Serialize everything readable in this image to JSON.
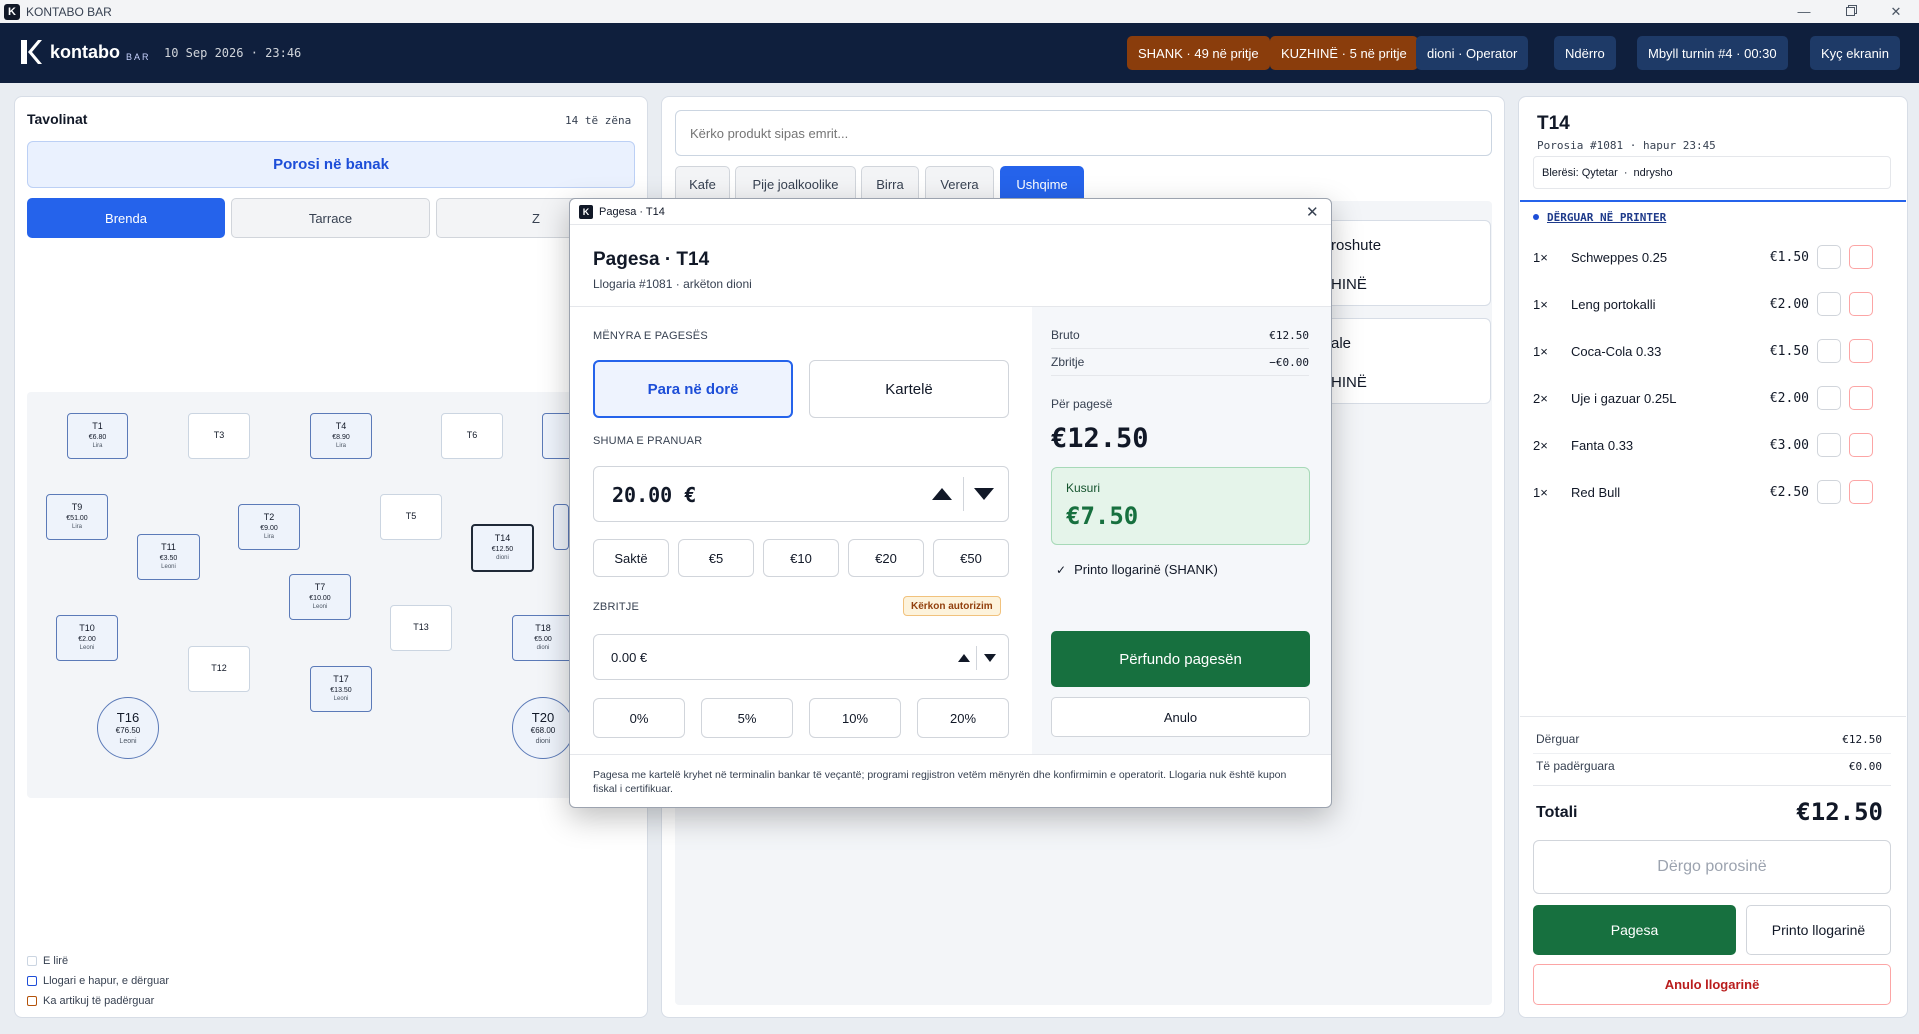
{
  "window": {
    "title": "KONTABO BAR",
    "logo_letter": "K"
  },
  "header": {
    "brand": "kontabo",
    "brand_sub": "BAR",
    "datetime": "10 Sep 2026 · 23:46",
    "shank_badge": "SHANK · 49 në pritje",
    "kitchen_badge": "KUZHINË · 5 në pritje",
    "operator": "dioni · Operator",
    "switch": "Ndërro",
    "close_shift": "Mbyll turnin #4 · 00:30",
    "lock": "Kyç ekranin",
    "colors": {
      "header_bg": "#0f1f3d",
      "badge_bg": "#8a3d0c",
      "button_bg": "#1e3a67"
    }
  },
  "tables_panel": {
    "title": "Tavolinat",
    "occupied": "14 të zëna",
    "bar_order": "Porosi në banak",
    "zones": [
      "Brenda",
      "Tarrace",
      "Z"
    ],
    "tables": [
      {
        "id": "T1",
        "amount": "€6.80",
        "waiter": "Lira",
        "status": "open"
      },
      {
        "id": "T3",
        "amount": "",
        "waiter": "",
        "status": "free"
      },
      {
        "id": "T4",
        "amount": "€8.90",
        "waiter": "Lira",
        "status": "open"
      },
      {
        "id": "T6",
        "amount": "",
        "waiter": "",
        "status": "free"
      },
      {
        "id": "T",
        "amount": "€",
        "waiter": "",
        "status": "open"
      },
      {
        "id": "T9",
        "amount": "€51.00",
        "waiter": "Lira",
        "status": "open"
      },
      {
        "id": "T2",
        "amount": "€9.00",
        "waiter": "Lira",
        "status": "open"
      },
      {
        "id": "T5",
        "amount": "",
        "waiter": "",
        "status": "free"
      },
      {
        "id": "T14",
        "amount": "€12.50",
        "waiter": "dioni",
        "status": "selected"
      },
      {
        "id": "T11",
        "amount": "€3.50",
        "waiter": "Leoni",
        "status": "open"
      },
      {
        "id": "T7",
        "amount": "€10.00",
        "waiter": "Leoni",
        "status": "open"
      },
      {
        "id": "T10",
        "amount": "€2.00",
        "waiter": "Leoni",
        "status": "open"
      },
      {
        "id": "T13",
        "amount": "",
        "waiter": "",
        "status": "free"
      },
      {
        "id": "T18",
        "amount": "€5.00",
        "waiter": "dioni",
        "status": "open"
      },
      {
        "id": "T12",
        "amount": "",
        "waiter": "",
        "status": "free"
      },
      {
        "id": "T17",
        "amount": "€13.50",
        "waiter": "Leoni",
        "status": "open"
      },
      {
        "id": "T16",
        "amount": "€76.50",
        "waiter": "Leoni",
        "status": "open"
      },
      {
        "id": "T20",
        "amount": "€68.00",
        "waiter": "dioni",
        "status": "open"
      }
    ],
    "legend": [
      "E lirë",
      "Llogari e hapur, e dërguar",
      "Ka artikuj të padërguar"
    ]
  },
  "products": {
    "search_placeholder": "Kërko produkt sipas emrit...",
    "categories": [
      "Kafe",
      "Pije joalkoolike",
      "Birra",
      "Verera",
      "Ushqime"
    ],
    "active_category": "Ushqime",
    "card1_text1": "roshute",
    "card1_text2": "HINË",
    "card2_text1": "ale",
    "card2_text2": "HINË"
  },
  "order_panel": {
    "table": "T14",
    "order_info": "Porosia #1081 · hapur 23:45",
    "buyer": "Blerësi: Qytetar",
    "change": "ndrysho",
    "section": "DËRGUAR NË PRINTER",
    "items": [
      {
        "qty": "1×",
        "name": "Schweppes 0.25",
        "price": "€1.50"
      },
      {
        "qty": "1×",
        "name": "Leng portokalli",
        "price": "€2.00"
      },
      {
        "qty": "1×",
        "name": "Coca-Cola 0.33",
        "price": "€1.50"
      },
      {
        "qty": "2×",
        "name": "Uje i gazuar 0.25L",
        "price": "€2.00"
      },
      {
        "qty": "2×",
        "name": "Fanta 0.33",
        "price": "€3.00"
      },
      {
        "qty": "1×",
        "name": "Red Bull",
        "price": "€2.50"
      }
    ],
    "sent_label": "Dërguar",
    "sent_value": "€12.50",
    "unsent_label": "Të padërguara",
    "unsent_value": "€0.00",
    "total_label": "Totali",
    "total_value": "€12.50",
    "send_order": "Dërgo porosinë",
    "payment": "Pagesa",
    "print_bill": "Printo llogarinë",
    "cancel_bill": "Anulo llogarinë"
  },
  "modal": {
    "window_title": "Pagesa · T14",
    "title": "Pagesa · T14",
    "subtitle": "Llogaria #1081 · arkëton dioni",
    "method_label": "MËNYRA E PAGESËS",
    "cash": "Para në dorë",
    "card": "Kartelë",
    "received_label": "SHUMA E PRANUAR",
    "received_value": "20.00 €",
    "quick": [
      "Saktë",
      "€5",
      "€10",
      "€20",
      "€50"
    ],
    "discount_label": "ZBRITJE",
    "auth_badge": "Kërkon autorizim",
    "discount_value": "0.00 €",
    "percents": [
      "0%",
      "5%",
      "10%",
      "20%"
    ],
    "gross_label": "Bruto",
    "gross_value": "€12.50",
    "disc_label": "Zbritje",
    "disc_value": "−€0.00",
    "due_label": "Për pagesë",
    "due_value": "€12.50",
    "change_label": "Kusuri",
    "change_value": "€7.50",
    "print_check": "Printo llogarinë (SHANK)",
    "finish": "Përfundo pagesën",
    "cancel": "Anulo",
    "footer": "Pagesa me kartelë kryhet në terminalin bankar të veçantë; programi regjistron vetëm mënyrën dhe konfirmimin e operatorit. Llogaria nuk është kupon fiskal i certifikuar."
  }
}
